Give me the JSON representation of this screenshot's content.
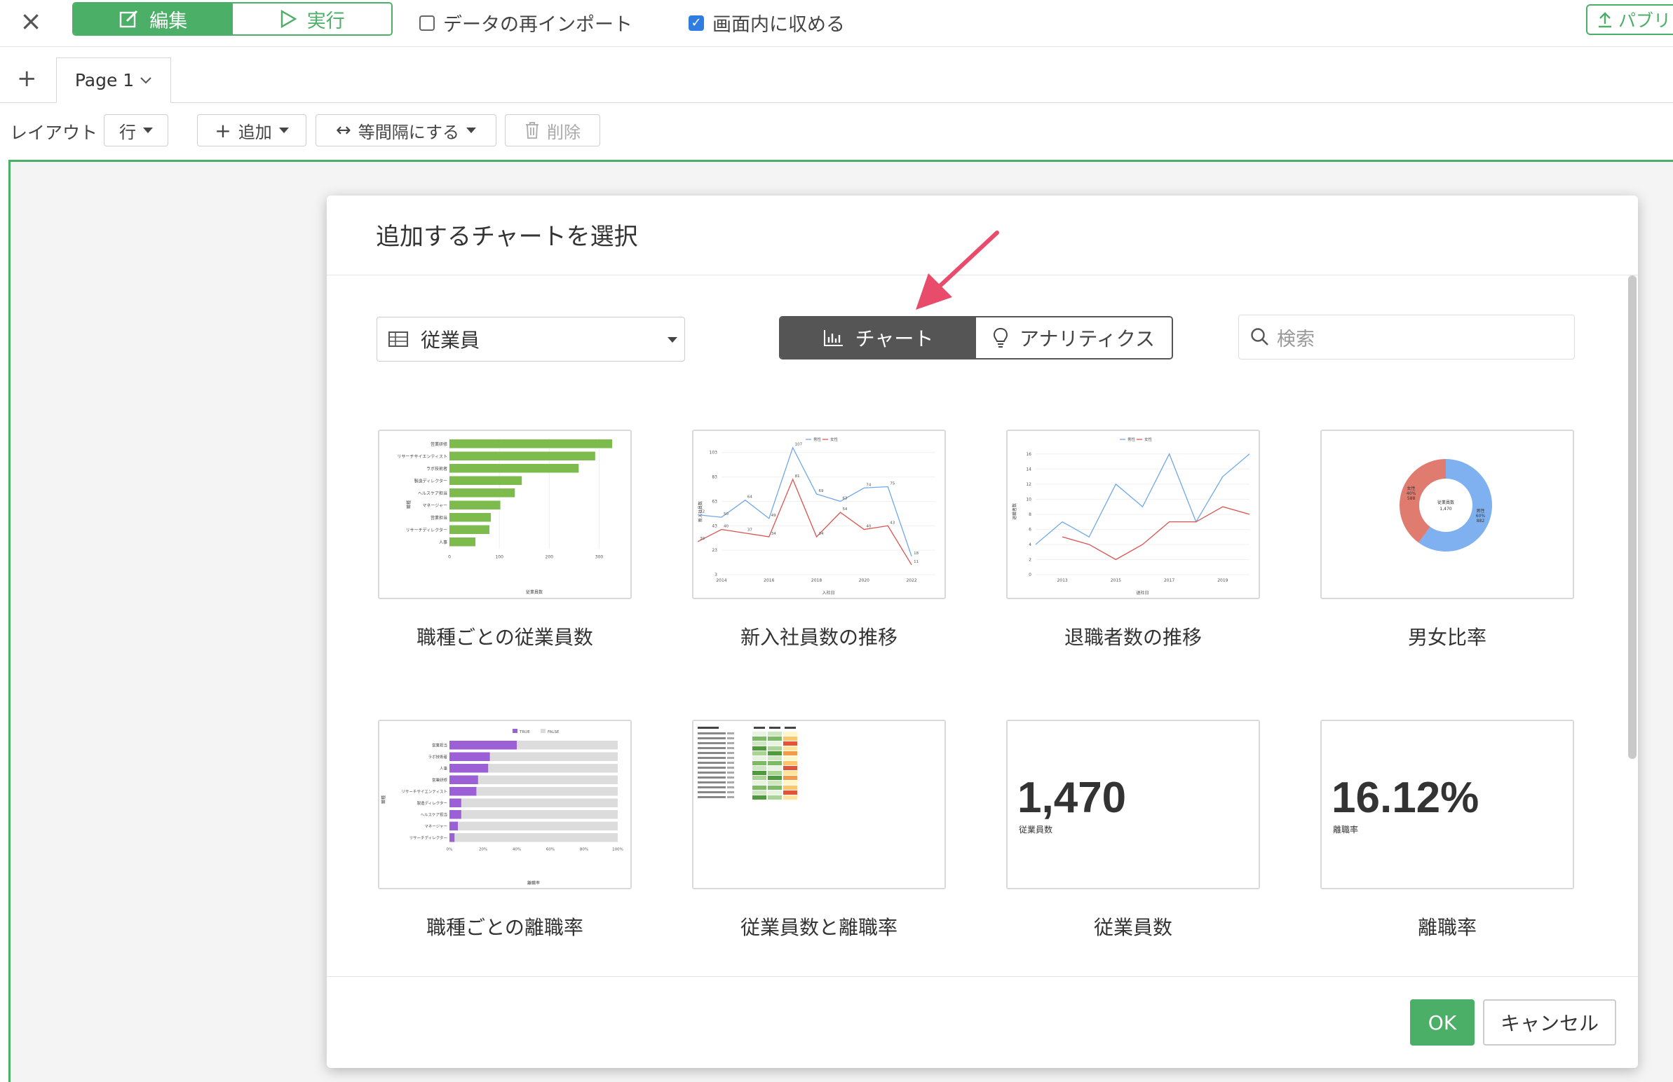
{
  "topbar": {
    "close_label": "×",
    "edit_label": "編集",
    "run_label": "実行",
    "reimport_label": "データの再インポート",
    "fit_label": "画面内に収める",
    "publish_label": "パブリ"
  },
  "tabs": {
    "add": "+",
    "page_label": "Page 1"
  },
  "toolbar": {
    "layout_label": "レイアウト",
    "row_label": "行",
    "add_label": "追加",
    "equal_label": "等間隔にする",
    "delete_label": "削除"
  },
  "modal": {
    "title": "追加するチャートを選択",
    "dataset": "従業員",
    "chart_tab": "チャート",
    "analytics_tab": "アナリティクス",
    "search_placeholder": "検索",
    "ok_label": "OK",
    "cancel_label": "キャンセル"
  },
  "cards": [
    {
      "label": "職種ごとの従業員数"
    },
    {
      "label": "新入社員数の推移"
    },
    {
      "label": "退職者数の推移"
    },
    {
      "label": "男女比率"
    },
    {
      "label": "職種ごとの離職率"
    },
    {
      "label": "従業員数と離職率"
    },
    {
      "label": "従業員数"
    },
    {
      "label": "離職率"
    }
  ],
  "chart_data": [
    {
      "type": "bar",
      "categories": [
        "営業研修",
        "リサーチサイエンティスト",
        "ラボ技術者",
        "製造ディレクター",
        "ヘルスケア担当",
        "マネージャー",
        "営業担当",
        "リサーチディレクター",
        "人事"
      ],
      "values": [
        326,
        292,
        259,
        145,
        131,
        102,
        83,
        80,
        52
      ],
      "xlabel": "従業員数",
      "ylabel": "職種",
      "ticks": [
        "0",
        "100",
        "200",
        "300"
      ]
    },
    {
      "type": "line",
      "legend": [
        "男性",
        "女性"
      ],
      "x": [
        2013,
        2014,
        2015,
        2016,
        2017,
        2018,
        2019,
        2020,
        2021,
        2022,
        2023
      ],
      "series": [
        {
          "name": "男性",
          "color": "#6fa8e8",
          "values": [
            52,
            50,
            64,
            49,
            107,
            69,
            63,
            74,
            75,
            18,
            null
          ]
        },
        {
          "name": "女性",
          "color": "#d9534f",
          "values": [
            30,
            40,
            37,
            34,
            81,
            34,
            54,
            40,
            43,
            11,
            null
          ]
        }
      ],
      "xlabel": "入社日",
      "ylabel": "新入社員数",
      "yticks": [
        "3",
        "23",
        "43",
        "63",
        "83",
        "103"
      ],
      "xticks": [
        "2014",
        "2016",
        "2018",
        "2020",
        "2022"
      ]
    },
    {
      "type": "line",
      "legend": [
        "男性",
        "女性"
      ],
      "x": [
        2012,
        2013,
        2014,
        2015,
        2016,
        2017,
        2018,
        2019,
        2020
      ],
      "series": [
        {
          "name": "男性",
          "color": "#6fa8e8",
          "values": [
            4,
            7,
            5,
            12,
            9,
            16,
            7,
            13,
            16
          ]
        },
        {
          "name": "女性",
          "color": "#d9534f",
          "values": [
            null,
            5,
            4,
            2,
            4,
            7,
            7,
            9,
            8
          ]
        }
      ],
      "xlabel": "退社日",
      "ylabel": "退職者数",
      "yticks": [
        "0",
        "2",
        "4",
        "6",
        "8",
        "10",
        "12",
        "14",
        "16"
      ],
      "xticks": [
        "2013",
        "2015",
        "2017",
        "2019"
      ]
    },
    {
      "type": "pie",
      "center_title": "従業員数",
      "center_value": "1,470",
      "slices": [
        {
          "name": "男性",
          "percent": "60%",
          "value": 882,
          "color": "#7fb0f0"
        },
        {
          "name": "女性",
          "percent": "40%",
          "value": 588,
          "color": "#e07b70"
        }
      ]
    },
    {
      "type": "bar",
      "legend": [
        "TRUE",
        "FALSE"
      ],
      "categories": [
        "営業担当",
        "ラボ技術者",
        "人事",
        "営業研修",
        "リサーチサイエンティスト",
        "製造ディレクター",
        "ヘルスケア担当",
        "マネージャー",
        "リサーチディレクター"
      ],
      "values": [
        40,
        24,
        23,
        17,
        16,
        7,
        7,
        5,
        3
      ],
      "xlabel": "離職率",
      "ylabel": "職種",
      "ticks": [
        "0%",
        "20%",
        "40%",
        "60%",
        "80%",
        "100%"
      ]
    },
    {
      "type": "table"
    }
  ],
  "kpis": [
    {
      "value": "1,470",
      "caption": "従業員数"
    },
    {
      "value": "16.12%",
      "caption": "離職率"
    }
  ]
}
